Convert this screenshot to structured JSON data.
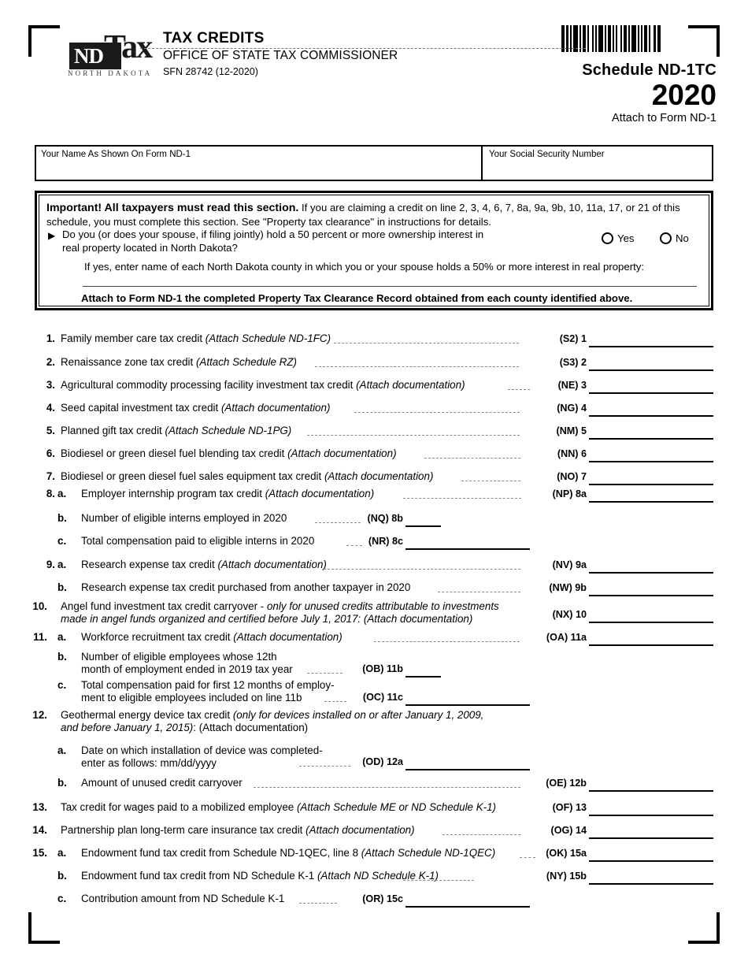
{
  "form": {
    "agency_logo_nd": "ND",
    "agency_logo_tax": "Tax",
    "agency_logo_sub": "NORTH DAKOTA",
    "title": "TAX CREDITS",
    "office": "OFFICE OF STATE TAX COMMISSIONER",
    "sfn": "SFN 28742 (12-2020)",
    "schedule": "Schedule ND-1TC",
    "year": "2020",
    "attach_to": "Attach to Form ND-1"
  },
  "identity": {
    "name_label": "Your Name As Shown On Form ND-1",
    "name_value": "",
    "ssn_label": "Your Social Security Number",
    "ssn_value": ""
  },
  "important": {
    "heading": "Important!  All taxpayers must read this section.",
    "intro": " If you are claiming a credit on line 2, 3, 4, 6, 7, 8a, 9a, 9b, 10, 11a, 17, or 21 of this schedule, you must complete this section. See \"Property tax clearance\" in instructions for details.",
    "question_line1": "Do you (or does your spouse, if filing jointly) hold a 50 percent or more ownership interest in",
    "question_line2": "real property located in North Dakota?",
    "yes_label": "Yes",
    "no_label": "No",
    "county_prompt": "If yes, enter name of each North Dakota county in which you or your spouse holds a 50% or more interest in real property:",
    "county_value": "",
    "footer": "Attach to Form ND-1 the completed Property Tax Clearance Record obtained from each county identified above."
  },
  "lines": [
    {
      "num": "1.",
      "sub": "",
      "text": "Family member care tax credit ",
      "italic": "(Attach Schedule ND-1FC)",
      "after": "",
      "code": "(S2) 1",
      "value": ""
    },
    {
      "num": "2.",
      "sub": "",
      "text": "Renaissance zone tax credit ",
      "italic": "(Attach Schedule RZ)",
      "after": "",
      "code": "(S3) 2",
      "value": ""
    },
    {
      "num": "3.",
      "sub": "",
      "text": "Agricultural commodity processing facility investment tax credit ",
      "italic": "(Attach documentation)",
      "after": "",
      "code": "(NE) 3",
      "value": ""
    },
    {
      "num": "4.",
      "sub": "",
      "text": "Seed capital investment tax credit ",
      "italic": "(Attach documentation)",
      "after": "",
      "code": "(NG) 4",
      "value": ""
    },
    {
      "num": "5.",
      "sub": "",
      "text": "Planned gift tax credit ",
      "italic": "(Attach Schedule ND-1PG)",
      "after": "",
      "code": "(NM) 5",
      "value": ""
    },
    {
      "num": "6.",
      "sub": "",
      "text": "Biodiesel or green diesel fuel blending tax credit ",
      "italic": "(Attach documentation)",
      "after": "",
      "code": "(NN) 6",
      "value": ""
    },
    {
      "num": "7.",
      "sub": "",
      "text": "Biodiesel or green diesel fuel sales equipment tax credit ",
      "italic": "(Attach documentation)",
      "after": "",
      "code": "(NO) 7",
      "value": ""
    },
    {
      "num": "8.",
      "sub": "a.",
      "text": "Employer internship program tax credit ",
      "italic": "(Attach documentation)",
      "after": "",
      "code": "(NP) 8a",
      "value": ""
    },
    {
      "num": "",
      "sub": "b.",
      "text": "Number of eligible interns employed in 2020",
      "italic": "",
      "after": "",
      "code": "(NQ) 8b",
      "value": ""
    },
    {
      "num": "",
      "sub": "c.",
      "text": "Total compensation paid to eligible interns in 2020",
      "italic": "",
      "after": "",
      "code": "(NR) 8c",
      "value": ""
    },
    {
      "num": "9.",
      "sub": "a.",
      "text": "Research expense tax credit ",
      "italic": "(Attach documentation)",
      "after": "",
      "code": "(NV) 9a",
      "value": ""
    },
    {
      "num": "",
      "sub": "b.",
      "text": "Research expense tax credit purchased from another taxpayer in 2020",
      "italic": "",
      "after": "",
      "code": "(NW) 9b",
      "value": ""
    },
    {
      "num": "10.",
      "sub": "",
      "text": "Angel fund investment tax credit carryover - ",
      "italic": "only for unused credits attributable to investments",
      "after": "",
      "line2_italic": "made in angel funds organized and certified before July 1, 2017: (Attach documentation)",
      "code": "(NX) 10",
      "value": ""
    },
    {
      "num": "11.",
      "sub": "a.",
      "text": "Workforce recruitment tax credit ",
      "italic": "(Attach documentation)",
      "after": "",
      "code": "(OA) 11a",
      "value": ""
    },
    {
      "num": "",
      "sub": "b.",
      "text": "Number of eligible employees whose 12th",
      "italic": "",
      "line2": "month of employment ended in 2019 tax year",
      "code": "(OB) 11b",
      "value": ""
    },
    {
      "num": "",
      "sub": "c.",
      "text": "Total compensation paid for first 12 months of employ-",
      "italic": "",
      "line2": "ment to eligible employees included on line 11b",
      "code": "(OC) 11c",
      "value": ""
    },
    {
      "num": "12.",
      "sub": "",
      "text": "Geothermal energy device tax credit ",
      "italic": "(only for devices installed on or after January 1, 2009,",
      "line2_italic": "and before January 1, 2015)",
      "line2_after": ": (Attach documentation)",
      "code": "",
      "value": ""
    },
    {
      "num": "",
      "sub": "a.",
      "text": "Date on which installation of device was completed-",
      "italic": "",
      "line2": "enter as follows: mm/dd/yyyy",
      "code": "(OD) 12a",
      "value": ""
    },
    {
      "num": "",
      "sub": "b.",
      "text": "Amount of unused credit carryover",
      "italic": "",
      "after": "",
      "code": "(OE) 12b",
      "value": ""
    },
    {
      "num": "13.",
      "sub": "",
      "text": "Tax credit for wages paid to a mobilized employee ",
      "italic": "(Attach Schedule ME or ND Schedule K-1)",
      "after": "",
      "code": "(OF) 13",
      "value": ""
    },
    {
      "num": "14.",
      "sub": "",
      "text": "Partnership plan long-term care insurance tax credit ",
      "italic": "(Attach documentation)",
      "after": "",
      "code": "(OG) 14",
      "value": ""
    },
    {
      "num": "15.",
      "sub": "a.",
      "text": "Endowment fund tax credit from Schedule ND-1QEC, line 8 ",
      "italic": "(Attach Schedule ND-1QEC)",
      "after": "",
      "code": "(OK) 15a",
      "value": ""
    },
    {
      "num": "",
      "sub": "b.",
      "text": "Endowment fund tax credit from ND Schedule K-1 ",
      "italic": "(Attach ND Schedule K-1)",
      "after": "",
      "code": "(NY) 15b",
      "value": ""
    },
    {
      "num": "",
      "sub": "c.",
      "text": "Contribution amount from ND Schedule K-1",
      "italic": "",
      "after": "",
      "code": "(OR) 15c",
      "value": ""
    }
  ],
  "barcode_pattern": [
    4,
    2,
    3,
    2,
    2,
    2,
    6,
    2,
    2,
    2,
    4,
    2,
    2,
    4,
    2,
    2,
    2,
    2,
    6,
    2,
    2,
    2,
    4,
    2,
    2,
    2,
    2,
    4,
    2,
    2,
    4,
    2,
    2,
    2,
    6,
    2,
    2,
    2,
    2,
    2,
    4,
    2,
    2,
    4,
    3,
    2,
    4
  ]
}
